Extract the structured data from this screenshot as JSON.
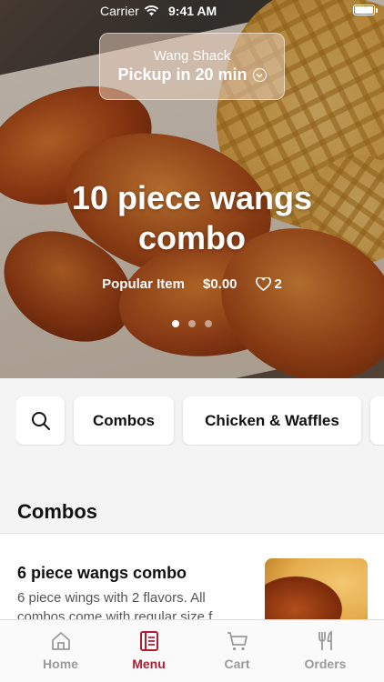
{
  "status_bar": {
    "carrier": "Carrier",
    "time": "9:41 AM"
  },
  "pickup": {
    "store": "Wang Shack",
    "time_label": "Pickup in 20 min"
  },
  "hero": {
    "title": "10 piece wangs combo",
    "tag": "Popular Item",
    "price": "$0.00",
    "favorites": "2",
    "carousel": {
      "pages": 3,
      "active": 1
    }
  },
  "categories": [
    "Combos",
    "Chicken & Waffles"
  ],
  "section": {
    "title": "Combos"
  },
  "items": [
    {
      "name": "6 piece wangs combo",
      "description": "6 piece wings with 2 flavors. All combos come with regular size f..."
    }
  ],
  "tabbar": {
    "tabs": [
      {
        "label": "Home",
        "icon": "home-icon",
        "active": false
      },
      {
        "label": "Menu",
        "icon": "menu-icon",
        "active": true
      },
      {
        "label": "Cart",
        "icon": "cart-icon",
        "active": false
      },
      {
        "label": "Orders",
        "icon": "utensils-icon",
        "active": false
      }
    ]
  },
  "colors": {
    "accent": "#b01c34",
    "inactive": "#9a9a9a"
  }
}
